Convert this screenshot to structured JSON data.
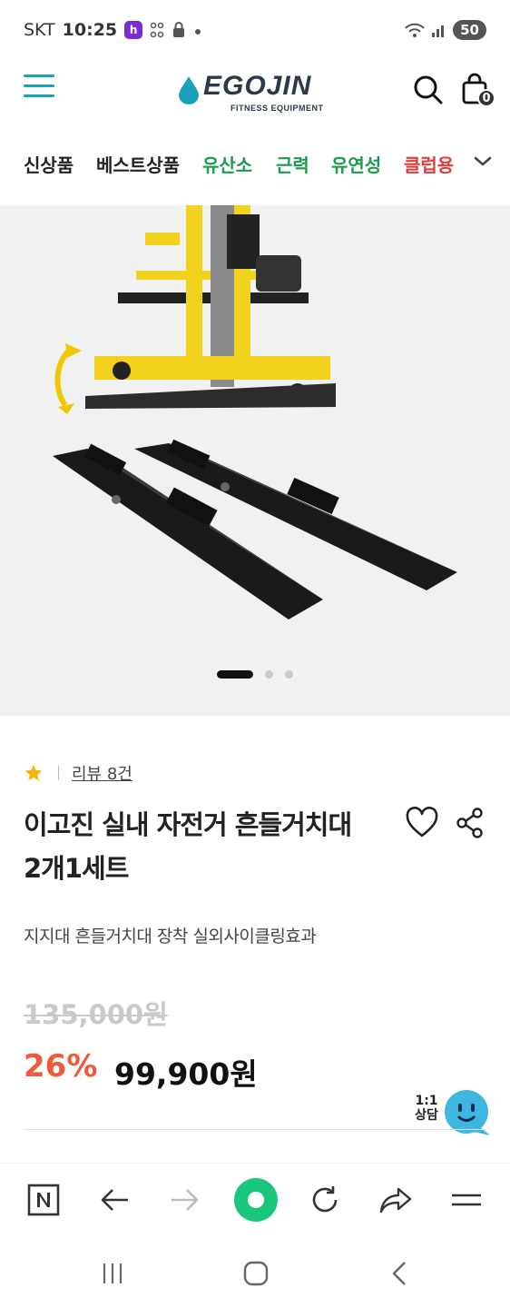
{
  "status_bar": {
    "carrier": "SKT",
    "time": "10:25",
    "app_badge": "h",
    "battery": "50"
  },
  "header": {
    "logo_text": "EGOJIN",
    "logo_sub": "FITNESS EQUIPMENT",
    "cart_count": "0",
    "icons": [
      "menu-icon",
      "search-icon",
      "shopping-bag-icon"
    ]
  },
  "categories": {
    "items": [
      {
        "label": "신상품",
        "color": "#222222"
      },
      {
        "label": "베스트상품",
        "color": "#222222"
      },
      {
        "label": "유산소",
        "color": "#1e9a4f"
      },
      {
        "label": "근력",
        "color": "#1e9a4f"
      },
      {
        "label": "유연성",
        "color": "#1e9a4f"
      },
      {
        "label": "클럽용",
        "color": "#e03c3c"
      }
    ]
  },
  "gallery": {
    "current_slide": 1,
    "total_slides": 3
  },
  "product": {
    "review_label": "리뷰 8건",
    "title_line1": "이고진 실내 자전거 흔들거치대",
    "title_line2": "2개1세트",
    "description": "지지대 흔들거치대 장착 실외사이클링효과",
    "original_price": "135,000원",
    "discount": "26%",
    "sale_price": "99,900원"
  },
  "chat": {
    "label_line1": "1:1",
    "label_line2": "상담"
  },
  "colors": {
    "brand": "#1aa3b8",
    "discount": "#ee5a3a",
    "rating_star": "#f4b400",
    "browser_home": "#19c77a"
  }
}
